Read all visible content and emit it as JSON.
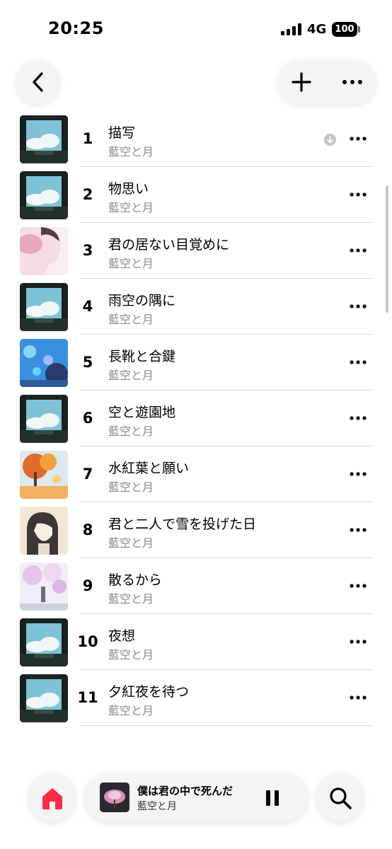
{
  "status_bar": {
    "time": "20:25",
    "network": "4G",
    "battery": "100"
  },
  "nav": {
    "back_icon": "chevron-left-icon",
    "add_icon": "plus-icon",
    "more_icon": "ellipsis-icon"
  },
  "tracks": [
    {
      "no": "1",
      "title": "描写",
      "artist": "藍空と月",
      "art": "sky-window",
      "downloaded": true
    },
    {
      "no": "2",
      "title": "物思い",
      "artist": "藍空と月",
      "art": "sky-window"
    },
    {
      "no": "3",
      "title": "君の居ない目覚めに",
      "artist": "藍空と月",
      "art": "pink-portrait"
    },
    {
      "no": "4",
      "title": "雨空の隅に",
      "artist": "藍空と月",
      "art": "sky-window"
    },
    {
      "no": "5",
      "title": "長靴と合鍵",
      "artist": "藍空と月",
      "art": "blue-flowers"
    },
    {
      "no": "6",
      "title": "空と遊園地",
      "artist": "藍空と月",
      "art": "sky-window"
    },
    {
      "no": "7",
      "title": "水紅葉と願い",
      "artist": "藍空と月",
      "art": "autumn-tree"
    },
    {
      "no": "8",
      "title": "君と二人で雪を投げた日",
      "artist": "藍空と月",
      "art": "girl-portrait"
    },
    {
      "no": "9",
      "title": "散るから",
      "artist": "藍空と月",
      "art": "cherry-blossom"
    },
    {
      "no": "10",
      "title": "夜想",
      "artist": "藍空と月",
      "art": "sky-window"
    },
    {
      "no": "11",
      "title": "夕紅夜を待つ",
      "artist": "藍空と月",
      "art": "sky-window"
    }
  ],
  "mini_player": {
    "title": "僕は君の中で死んだ",
    "artist": "藍空と月",
    "state": "playing"
  },
  "tab_bar": {
    "home_icon": "home-icon",
    "search_icon": "search-icon"
  },
  "colors": {
    "accent": "#fa2d48",
    "secondary_text": "#8a8a8e",
    "divider": "#dcdcde"
  }
}
